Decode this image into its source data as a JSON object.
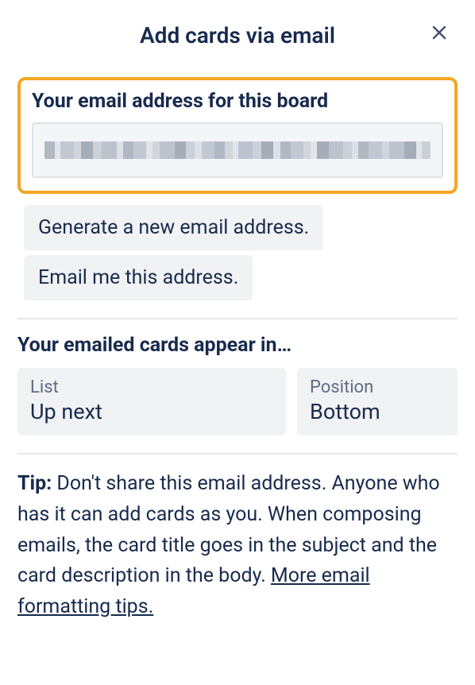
{
  "dialog": {
    "title": "Add cards via email"
  },
  "emailSection": {
    "label": "Your email address for this board",
    "value_redacted": true
  },
  "actions": {
    "generate": "Generate a new email address.",
    "emailMe": "Email me this address."
  },
  "destination": {
    "header": "Your emailed cards appear in…",
    "listLabel": "List",
    "listValue": "Up next",
    "positionLabel": "Position",
    "positionValue": "Bottom"
  },
  "tip": {
    "label": "Tip:",
    "body": " Don't share this email address. Anyone who has it can add cards as you. When composing emails, the card title goes in the subject and the card description in the body. ",
    "linkText": "More email formatting tips."
  }
}
